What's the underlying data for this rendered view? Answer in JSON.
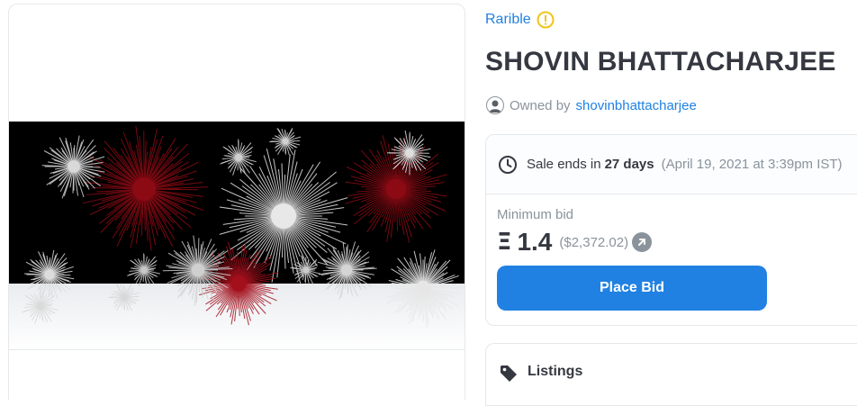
{
  "collection": {
    "name": "Rarible",
    "warning_icon": "warning-circle-icon"
  },
  "item": {
    "title": "SHOVIN BHATTACHARJEE"
  },
  "owner": {
    "prefix": "Owned by",
    "name": "shovinbhattacharjee"
  },
  "sale": {
    "prefix": "Sale ends in",
    "remaining": "27 days",
    "date": "(April 19, 2021 at 3:39pm IST)"
  },
  "bid": {
    "label": "Minimum bid",
    "currency_symbol": "Ξ",
    "amount": "1.4",
    "usd": "($2,372.02)",
    "button_label": "Place Bid"
  },
  "listings": {
    "label": "Listings"
  },
  "colors": {
    "accent": "#2081e2",
    "text": "#353840",
    "muted": "#8a939b",
    "warning": "#f0c419"
  }
}
